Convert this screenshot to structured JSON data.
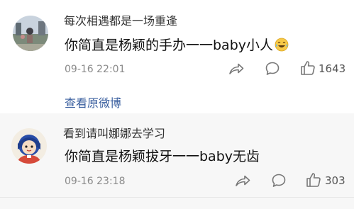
{
  "comments": [
    {
      "username": "每次相遇都是一场重逢",
      "text": "你简直是杨颖的手办一一baby小人",
      "timestamp": "09-16 22:01",
      "like_count": "1643",
      "emoji_icon": "laughing-tears-emoji",
      "view_original": "查看原微博"
    },
    {
      "username": "看到请叫娜娜去学习",
      "text": "你简直是杨颖拔牙一一baby无齿",
      "timestamp": "09-16 23:18",
      "like_count": "303"
    }
  ],
  "colors": {
    "link": "#3a5f9f",
    "muted": "#8a8a8a",
    "text": "#111111",
    "alt_background": "#f7f7f7"
  }
}
